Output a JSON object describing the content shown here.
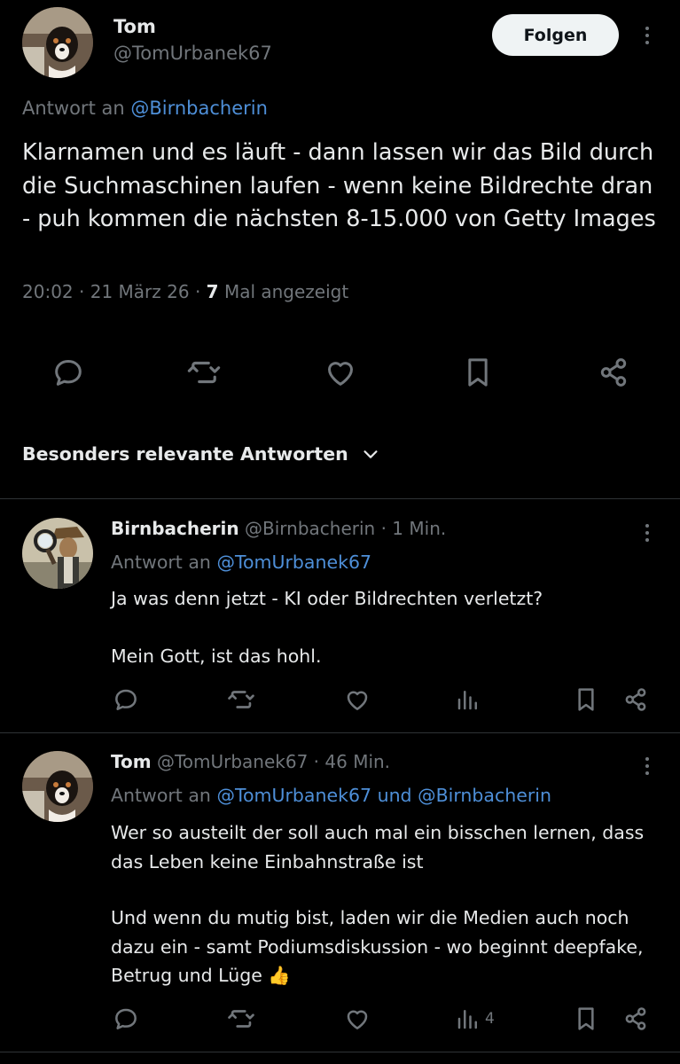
{
  "tweet": {
    "author_name": "Tom",
    "author_handle": "@TomUrbanek67",
    "follow_label": "Folgen",
    "reply_prefix": "Antwort an",
    "reply_mention": "@Birnbacherin",
    "text": "Klarnamen und es läuft - dann lassen wir das Bild durch die Suchmaschinen laufen - wenn keine Bildrechte dran - puh kommen die nächsten 8-15.000 von Getty Images",
    "time": "20:02",
    "date": "21 März 26",
    "views_count": "7",
    "views_label": "Mal angezeigt",
    "separator": "·"
  },
  "replies_header": {
    "label": "Besonders relevante Antworten"
  },
  "replies": [
    {
      "name": "Birnbacherin",
      "handle": "@Birnbacherin",
      "time": "1 Min.",
      "reply_prefix": "Antwort an",
      "reply_mentions": "@TomUrbanek67",
      "paragraph_1": "Ja was denn jetzt - KI oder Bildrechten verletzt?",
      "paragraph_2": "Mein Gott, ist das hohl.",
      "views": ""
    },
    {
      "name": "Tom",
      "handle": "@TomUrbanek67",
      "time": "46 Min.",
      "reply_prefix": "Antwort an",
      "reply_mentions": "@TomUrbanek67 und @Birnbacherin",
      "paragraph_1": "Wer so austeilt der soll auch mal ein bisschen lernen, dass das Leben keine Einbahnstraße ist",
      "paragraph_2": "Und wenn du mutig bist, laden wir die Medien auch noch dazu ein - samt Podiumsdiskussion - wo beginnt deepfake, Betrug und Lüge 👍",
      "views": "4"
    }
  ],
  "icons": {
    "reply": "reply-icon",
    "repost": "repost-icon",
    "like": "like-icon",
    "bookmark": "bookmark-icon",
    "share": "share-icon",
    "views": "views-icon",
    "more": "more-icon",
    "chevron": "chevron-down-icon"
  },
  "colors": {
    "background": "#000000",
    "text": "#e7e9ea",
    "secondary": "#71767b",
    "link": "#4e8fd8",
    "follow_bg": "#eff3f4",
    "divider": "#2f3336"
  }
}
